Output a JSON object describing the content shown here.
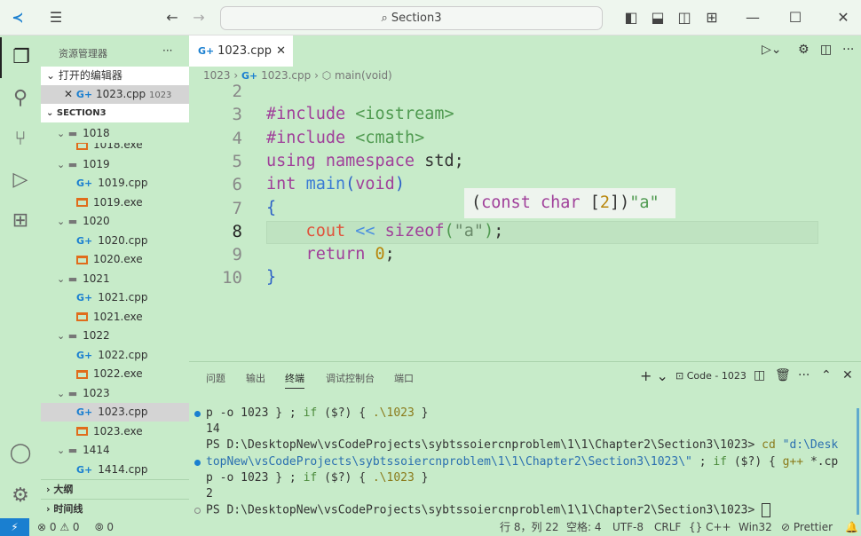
{
  "titlebar": {
    "search": "Section3",
    "icons": [
      "vscode-logo-icon",
      "menu-icon",
      "back-icon",
      "forward-icon",
      "search-icon",
      "toggle-sidebar-icon",
      "toggle-panel-icon",
      "toggle-secondary-icon",
      "customize-layout-icon",
      "minimize-icon",
      "maximize-icon",
      "close-icon"
    ]
  },
  "sidebar": {
    "title": "资源管理器",
    "more": "···",
    "open_editors": "打开的编辑器",
    "open_file": {
      "name": "1023.cpp",
      "desc": "1023"
    },
    "section": "SECTION3",
    "sticky": {
      "name": "1018",
      "type": "folder"
    },
    "tree": [
      {
        "name": "1018.exe",
        "type": "exe"
      },
      {
        "name": "1019",
        "type": "folder"
      },
      {
        "name": "1019.cpp",
        "type": "cpp"
      },
      {
        "name": "1019.exe",
        "type": "exe"
      },
      {
        "name": "1020",
        "type": "folder"
      },
      {
        "name": "1020.cpp",
        "type": "cpp"
      },
      {
        "name": "1020.exe",
        "type": "exe"
      },
      {
        "name": "1021",
        "type": "folder"
      },
      {
        "name": "1021.cpp",
        "type": "cpp"
      },
      {
        "name": "1021.exe",
        "type": "exe"
      },
      {
        "name": "1022",
        "type": "folder"
      },
      {
        "name": "1022.cpp",
        "type": "cpp"
      },
      {
        "name": "1022.exe",
        "type": "exe"
      },
      {
        "name": "1023",
        "type": "folder"
      },
      {
        "name": "1023.cpp",
        "type": "cpp",
        "selected": true
      },
      {
        "name": "1023.exe",
        "type": "exe"
      },
      {
        "name": "1414",
        "type": "folder"
      },
      {
        "name": "1414.cpp",
        "type": "cpp"
      }
    ],
    "outline": "大纲",
    "timeline": "时间线"
  },
  "editor": {
    "tab": "1023.cpp",
    "breadcrumb": [
      "1023",
      "1023.cpp",
      "main(void)"
    ],
    "lines": [
      {
        "n": "2",
        "t": []
      },
      {
        "n": "3",
        "t": [
          [
            "#include ",
            "#a0409a"
          ],
          [
            "<iostream>",
            "#4f9a50"
          ]
        ]
      },
      {
        "n": "4",
        "t": [
          [
            "#include ",
            "#a0409a"
          ],
          [
            "<cmath>",
            "#4f9a50"
          ]
        ]
      },
      {
        "n": "5",
        "t": [
          [
            "using namespace ",
            "#a0409a"
          ],
          [
            "std;",
            "#333"
          ]
        ]
      },
      {
        "n": "6",
        "t": [
          [
            "int ",
            "#a0409a"
          ],
          [
            "main",
            "#3a7bd5"
          ],
          [
            "(",
            "#2a5fc7"
          ],
          [
            "void",
            "#a0409a"
          ],
          [
            ")",
            "#2a5fc7"
          ]
        ]
      },
      {
        "n": "7",
        "t": [
          [
            "{",
            "#2a5fc7"
          ]
        ]
      },
      {
        "n": "8",
        "t": [
          [
            "    cout ",
            "#e0533c"
          ],
          [
            "<< ",
            "#4a8ee0"
          ],
          [
            "sizeof",
            "#a0409a"
          ],
          [
            "(",
            "#4f9a50"
          ],
          [
            "\"a\"",
            "#6a8a6a"
          ],
          [
            ")",
            "#4f9a50"
          ],
          [
            ";",
            "#333"
          ]
        ]
      },
      {
        "n": "9",
        "t": [
          [
            "    return ",
            "#a0409a"
          ],
          [
            "0",
            "#b8860b"
          ],
          [
            ";",
            "#333"
          ]
        ]
      },
      {
        "n": "10",
        "t": [
          [
            "}",
            "#2a5fc7"
          ]
        ]
      }
    ],
    "hover": [
      [
        "(",
        "#333"
      ],
      [
        "const char ",
        "#a0409a"
      ],
      [
        "[",
        "#333"
      ],
      [
        "2",
        "#b8860b"
      ],
      [
        "])",
        "#333"
      ],
      [
        "\"a\"",
        "#4f9a50"
      ]
    ]
  },
  "panel": {
    "tabs": [
      "问题",
      "输出",
      "终端",
      "调试控制台",
      "端口"
    ],
    "active": "终端",
    "terminal_name": "Code - 1023",
    "lines": [
      {
        "dot": "blue",
        "t": [
          [
            "p -o 1023 } ; ",
            "#333"
          ],
          [
            "if ",
            "#4a8a3a"
          ],
          [
            "($?) { ",
            "#333"
          ],
          [
            ".\\1023 ",
            "#8a7a1a"
          ],
          [
            "}",
            "#333"
          ]
        ]
      },
      {
        "t": [
          [
            "14",
            "#333"
          ]
        ]
      },
      {
        "t": [
          [
            "PS D:\\DesktopNew\\vsCodeProjects\\sybtssoiercnproblem\\1\\1\\Chapter2\\Section3\\1023> ",
            "#333"
          ],
          [
            "cd ",
            "#8a7a1a"
          ],
          [
            "\"d:\\Desk",
            "#2a6fb0"
          ]
        ]
      },
      {
        "dot": "blue",
        "t": [
          [
            "topNew\\vsCodeProjects\\sybtssoiercnproblem\\1\\1\\Chapter2\\Section3\\1023\\\"",
            "#2a6fb0"
          ],
          [
            " ; ",
            "#333"
          ],
          [
            "if ",
            "#4a8a3a"
          ],
          [
            "($?) { ",
            "#333"
          ],
          [
            "g++ ",
            "#8a7a1a"
          ],
          [
            "*.cp",
            "#333"
          ]
        ]
      },
      {
        "t": [
          [
            "p -o 1023 } ; ",
            "#333"
          ],
          [
            "if ",
            "#4a8a3a"
          ],
          [
            "($?) { ",
            "#333"
          ],
          [
            ".\\1023 ",
            "#8a7a1a"
          ],
          [
            "}",
            "#333"
          ]
        ]
      },
      {
        "t": [
          [
            "2",
            "#333"
          ]
        ]
      },
      {
        "dot": "hollow",
        "t": [
          [
            "PS D:\\DesktopNew\\vsCodeProjects\\sybtssoiercnproblem\\1\\1\\Chapter2\\Section3\\1023> ",
            "#333"
          ]
        ]
      }
    ]
  },
  "status": {
    "remote": "⚡",
    "errors": "0",
    "warnings": "0",
    "ports": "0",
    "position": "行 8，列 22",
    "spaces": "空格: 4",
    "encoding": "UTF-8",
    "eol": "CRLF",
    "language": "C++",
    "platform": "Win32",
    "prettier": "Prettier"
  },
  "colors": {
    "background": "#c7ebc9",
    "accent": "#1a7fd0",
    "remote": "#1a7fd0"
  }
}
